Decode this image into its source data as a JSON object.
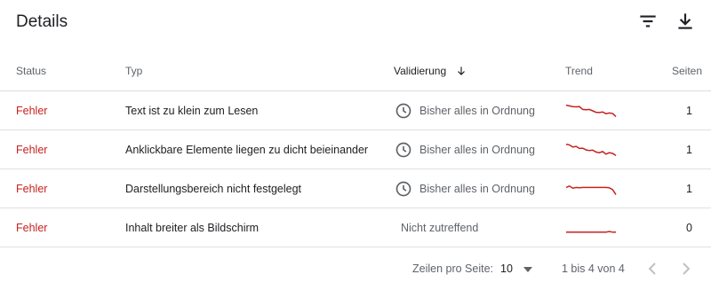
{
  "header": {
    "title": "Details"
  },
  "columns": {
    "status": "Status",
    "type": "Typ",
    "validation": "Validierung",
    "trend": "Trend",
    "pages": "Seiten"
  },
  "rows": [
    {
      "status": "Fehler",
      "type": "Text ist zu klein zum Lesen",
      "validation": "Bisher alles in Ordnung",
      "has_clock": true,
      "pages": "1",
      "trend": [
        0.9,
        0.85,
        0.8,
        0.78,
        0.8,
        0.6,
        0.58,
        0.6,
        0.5,
        0.4,
        0.38,
        0.42,
        0.3,
        0.35,
        0.32,
        0.1
      ]
    },
    {
      "status": "Fehler",
      "type": "Anklickbare Elemente liegen zu dicht beieinander",
      "validation": "Bisher alles in Ordnung",
      "has_clock": true,
      "pages": "1",
      "trend": [
        0.9,
        0.85,
        0.7,
        0.75,
        0.6,
        0.62,
        0.5,
        0.45,
        0.48,
        0.35,
        0.3,
        0.38,
        0.2,
        0.3,
        0.25,
        0.1
      ]
    },
    {
      "status": "Fehler",
      "type": "Darstellungsbereich nicht festgelegt",
      "validation": "Bisher alles in Ordnung",
      "has_clock": true,
      "pages": "1",
      "trend": [
        0.6,
        0.7,
        0.55,
        0.6,
        0.58,
        0.6,
        0.6,
        0.6,
        0.6,
        0.6,
        0.6,
        0.6,
        0.6,
        0.58,
        0.45,
        0.1
      ]
    },
    {
      "status": "Fehler",
      "type": "Inhalt breiter als Bildschirm",
      "validation": "Nicht zutreffend",
      "has_clock": false,
      "pages": "0",
      "trend": [
        0.2,
        0.2,
        0.2,
        0.2,
        0.2,
        0.2,
        0.2,
        0.2,
        0.2,
        0.2,
        0.2,
        0.2,
        0.2,
        0.25,
        0.2,
        0.2
      ]
    }
  ],
  "footer": {
    "rows_per_page_label": "Zeilen pro Seite:",
    "rows_per_page_value": "10",
    "range": "1 bis 4 von 4"
  },
  "colors": {
    "error": "#c5221f",
    "trend_line": "#c5221f",
    "icon": "#5f6368"
  },
  "icons": {
    "filter": "filter-icon",
    "download": "download-icon",
    "sort": "arrow-down-icon",
    "clock": "clock-icon",
    "prev": "chevron-left-icon",
    "next": "chevron-right-icon"
  }
}
